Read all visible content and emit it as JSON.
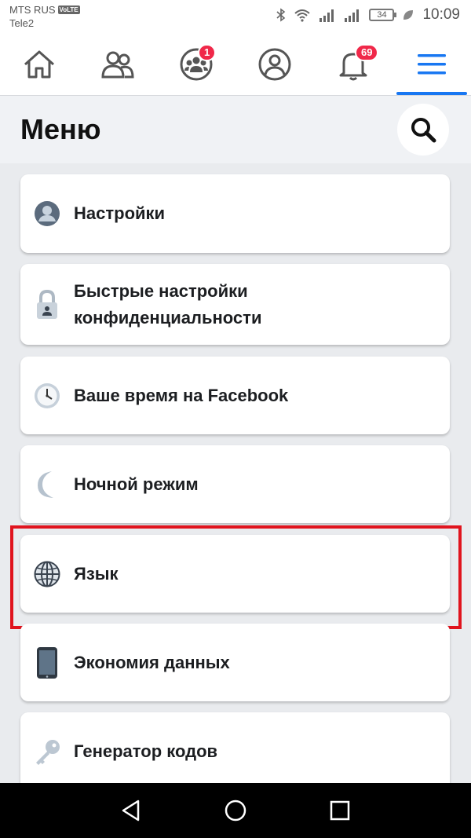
{
  "status_bar": {
    "carrier_1": "MTS RUS",
    "volte": "VoLTE",
    "carrier_2": "Tele2",
    "battery": "34",
    "time": "10:09"
  },
  "nav": {
    "groups_badge": "1",
    "notifications_badge": "69"
  },
  "header": {
    "title": "Меню"
  },
  "menu_items": [
    {
      "label": "Настройки",
      "icon": "settings-profile-icon"
    },
    {
      "label_line1": "Быстрые настройки",
      "label_line2": "конфиденциальности",
      "icon": "lock-icon"
    },
    {
      "label": "Ваше время на Facebook",
      "icon": "clock-icon"
    },
    {
      "label": "Ночной режим",
      "icon": "moon-icon"
    },
    {
      "label": "Язык",
      "icon": "globe-icon"
    },
    {
      "label": "Экономия данных",
      "icon": "phone-icon"
    },
    {
      "label": "Генератор кодов",
      "icon": "key-icon"
    }
  ],
  "colors": {
    "accent": "#1877f2",
    "badge": "#f02849",
    "highlight": "#e0141e"
  }
}
